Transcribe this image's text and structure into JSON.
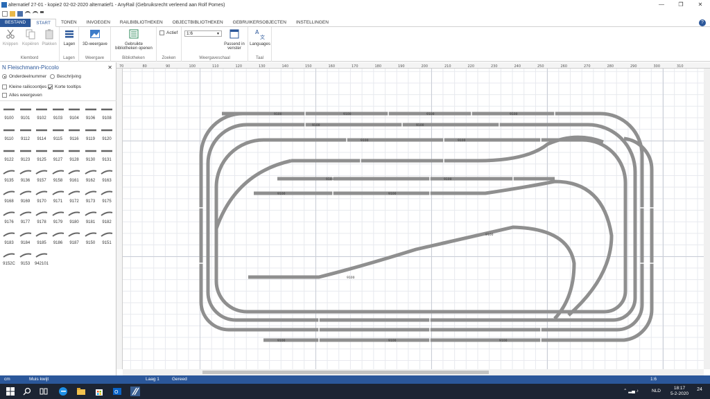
{
  "window": {
    "title": "alternatief 27-01 - kopie2 02-02-2020 alternatief1 - AnyRail (Gebruiksrecht verleend aan Rolf Pomes)",
    "minimize": "—",
    "maximize": "❐",
    "close": "✕"
  },
  "tabs": [
    "BESTAND",
    "START",
    "TONEN",
    "INVOEGEN",
    "RAILBIBLIOTHEKEN",
    "OBJECTBIBLIOTHEKEN",
    "GEBRUIKERSOBJECTEN",
    "INSTELLINGEN"
  ],
  "help": "?",
  "ribbon": {
    "klembord": {
      "name": "Klembord",
      "knippen": "Knippen",
      "kopieren": "Kopiëren",
      "plakken": "Plakken"
    },
    "lagen": {
      "name": "Lagen",
      "lagen": "Lagen"
    },
    "weergave": {
      "name": "Weergave",
      "3d": "3D-weergave"
    },
    "bibliotheken": {
      "name": "Bibliotheken",
      "open_line1": "Gebruikte",
      "open_line2": "bibliotheken openen"
    },
    "zoeken": {
      "name": "Zoeken",
      "actief": "Actief"
    },
    "weergaveschaal": {
      "name": "Weergaveschaal",
      "scale": "1:6",
      "fit_line1": "Passend in",
      "fit_line2": "venster"
    },
    "taal": {
      "name": "Taal",
      "languages": "Languages"
    }
  },
  "sidebar": {
    "title": "N Fleischmann-Piccolo",
    "close": "✕",
    "options": {
      "onderdeelnummer": "Onderdeelnummer",
      "beschrijving": "Beschrijving",
      "kleine": "Kleine railicoontjes",
      "korte": "Korte tooltips",
      "alles": "Alles weergeven"
    },
    "tracks": [
      "9100",
      "9101",
      "9102",
      "9103",
      "9104",
      "9106",
      "9108",
      "9110",
      "9112",
      "9114",
      "9115",
      "9116",
      "9119",
      "9120",
      "9122",
      "9123",
      "9125",
      "9127",
      "9128",
      "9130",
      "9131",
      "9135",
      "9136",
      "9157",
      "9158",
      "9161",
      "9162",
      "9163",
      "9168",
      "9169",
      "9170",
      "9171",
      "9172",
      "9173",
      "9175",
      "9176",
      "9177",
      "9178",
      "9179",
      "9180",
      "9181",
      "9182",
      "9183",
      "9184",
      "9185",
      "9186",
      "9187",
      "9150",
      "9151",
      "9152C",
      "9153",
      "942101"
    ]
  },
  "ruler": {
    "top": [
      "70",
      "80",
      "90",
      "100",
      "110",
      "120",
      "130",
      "140",
      "150",
      "160",
      "170",
      "180",
      "190",
      "200",
      "210",
      "220",
      "230",
      "240",
      "250",
      "260",
      "270",
      "280",
      "290",
      "300",
      "310"
    ]
  },
  "status": {
    "unit": "cm",
    "mouse": "Muis kwijt",
    "layer": "Laag 1",
    "state": "Gereed",
    "scale": "1:6"
  },
  "taskbar": {
    "lang": "NLD",
    "time": "18:17",
    "date": "5-2-2020",
    "notifications": "24"
  },
  "colors": {
    "accent": "#2b579a",
    "track": "#8f8f8f",
    "taskbar": "#1c2433"
  }
}
